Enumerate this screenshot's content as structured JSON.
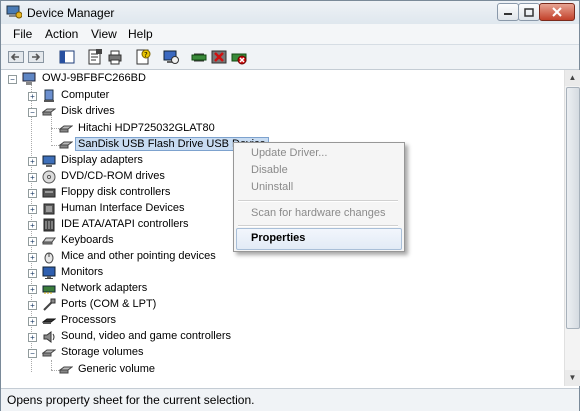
{
  "window": {
    "title": "Device Manager"
  },
  "menu": [
    "File",
    "Action",
    "View",
    "Help"
  ],
  "tree": {
    "root": "OWJ-9BFBFC266BD",
    "nodes": [
      {
        "label": "Computer",
        "icon": "computer-icon",
        "expanded": false
      },
      {
        "label": "Disk drives",
        "icon": "disk-drive-icon",
        "expanded": true,
        "children": [
          "Hitachi HDP725032GLAT80",
          "SanDisk USB Flash Drive USB Device"
        ]
      },
      {
        "label": "Display adapters",
        "icon": "display-adapter-icon",
        "expanded": false
      },
      {
        "label": "DVD/CD-ROM drives",
        "icon": "cdrom-icon",
        "expanded": false
      },
      {
        "label": "Floppy disk controllers",
        "icon": "floppy-controller-icon",
        "expanded": false
      },
      {
        "label": "Human Interface Devices",
        "icon": "hid-icon",
        "expanded": false
      },
      {
        "label": "IDE ATA/ATAPI controllers",
        "icon": "ide-controller-icon",
        "expanded": false
      },
      {
        "label": "Keyboards",
        "icon": "keyboard-icon",
        "expanded": false
      },
      {
        "label": "Mice and other pointing devices",
        "icon": "mouse-icon",
        "expanded": false
      },
      {
        "label": "Monitors",
        "icon": "monitor-icon",
        "expanded": false
      },
      {
        "label": "Network adapters",
        "icon": "network-adapter-icon",
        "expanded": false
      },
      {
        "label": "Ports (COM & LPT)",
        "icon": "port-icon",
        "expanded": false
      },
      {
        "label": "Processors",
        "icon": "processor-icon",
        "expanded": false
      },
      {
        "label": "Sound, video and game controllers",
        "icon": "sound-icon",
        "expanded": false
      },
      {
        "label": "Storage volumes",
        "icon": "storage-volume-icon",
        "expanded": true,
        "children": [
          "Generic volume"
        ]
      }
    ],
    "selected": "SanDisk USB Flash Drive USB Device"
  },
  "context_menu": {
    "items": [
      {
        "label": "Update Driver...",
        "enabled": false
      },
      {
        "label": "Disable",
        "enabled": false
      },
      {
        "label": "Uninstall",
        "enabled": false
      },
      {
        "label": "Scan for hardware changes",
        "enabled": false
      },
      {
        "label": "Properties",
        "enabled": true,
        "bold": true,
        "highlighted": true
      }
    ]
  },
  "status": "Opens property sheet for the current selection.",
  "colors": {
    "selection": "#c8dcf2",
    "close_button": "#c2412a"
  }
}
